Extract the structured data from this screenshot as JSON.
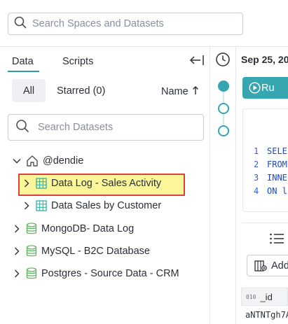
{
  "search": {
    "placeholder": "Search Spaces and Datasets"
  },
  "tabs": [
    {
      "label": "Data",
      "active": true
    },
    {
      "label": "Scripts",
      "active": false
    }
  ],
  "filters": {
    "all": "All",
    "starred": "Starred (0)",
    "sort": "Name"
  },
  "dataset_search": {
    "placeholder": "Search Datasets"
  },
  "tree": {
    "space": "@dendie",
    "datasets": [
      {
        "label": "Data Log - Sales Activity",
        "highlighted": true
      },
      {
        "label": "Data Sales by Customer",
        "highlighted": false
      }
    ],
    "connections": [
      {
        "label": "MongoDB- Data Log"
      },
      {
        "label": "MySQL - B2C Database"
      },
      {
        "label": "Postgres - Source Data - CRM"
      }
    ]
  },
  "history": {
    "date": "Sep 25, 20"
  },
  "editor": {
    "run_label": "Ru",
    "lines": [
      {
        "num": "1",
        "text": "SELE"
      },
      {
        "num": "2",
        "text": "FROM"
      },
      {
        "num": "3",
        "text": "INNE"
      },
      {
        "num": "4",
        "text": "ON l"
      }
    ]
  },
  "results": {
    "add_label": "Add",
    "column_type": "010",
    "column_name": "_id",
    "first_cell": "aNTNTgh7A"
  },
  "colors": {
    "accent": "#36a6b1",
    "highlight_bg": "#fbf69a",
    "highlight_border": "#d9423a",
    "dataset_icon": "#2fb3a4",
    "db_icon": "#5cb85c"
  }
}
